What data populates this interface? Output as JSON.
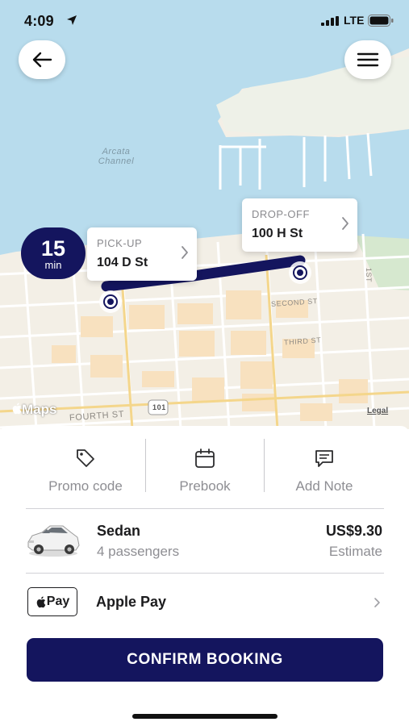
{
  "status_bar": {
    "time": "4:09",
    "network": "LTE"
  },
  "map": {
    "water_label_line1": "Arcata",
    "water_label_line2": "Channel",
    "streets": [
      "SECOND ST",
      "THIRD ST",
      "FOURTH ST",
      "1ST"
    ],
    "highway_shield": "101",
    "provider_label": "Maps",
    "legal_link": "Legal"
  },
  "eta": {
    "value": "15",
    "unit": "min"
  },
  "pickup": {
    "kicker": "PICK-UP",
    "address": "104 D St"
  },
  "dropoff": {
    "kicker": "DROP-OFF",
    "address": "100 H St"
  },
  "actions": [
    {
      "label": "Promo code",
      "icon": "tag-icon"
    },
    {
      "label": "Prebook",
      "icon": "calendar-icon"
    },
    {
      "label": "Add Note",
      "icon": "message-icon"
    }
  ],
  "vehicle": {
    "name": "Sedan",
    "capacity": "4 passengers",
    "price": "US$9.30",
    "price_note": "Estimate"
  },
  "payment": {
    "badge_text": "Pay",
    "method": "Apple Pay"
  },
  "confirm_label": "CONFIRM BOOKING",
  "colors": {
    "brand_navy": "#14155e",
    "water": "#b8dced",
    "land": "#f3efe6",
    "block_orange": "#f8e1bf"
  }
}
